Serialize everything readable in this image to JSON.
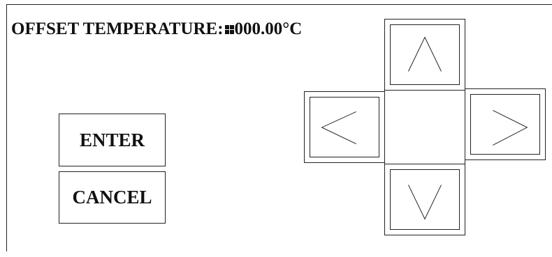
{
  "title": {
    "label": "OFFSET TEMPERATURE:",
    "value": "000.00°C"
  },
  "buttons": {
    "enter": "ENTER",
    "cancel": "CANCEL"
  },
  "icons": {
    "cursor": "cursor-marker-icon",
    "up": "chevron-up-icon",
    "down": "chevron-down-icon",
    "left": "chevron-left-icon",
    "right": "chevron-right-icon"
  }
}
